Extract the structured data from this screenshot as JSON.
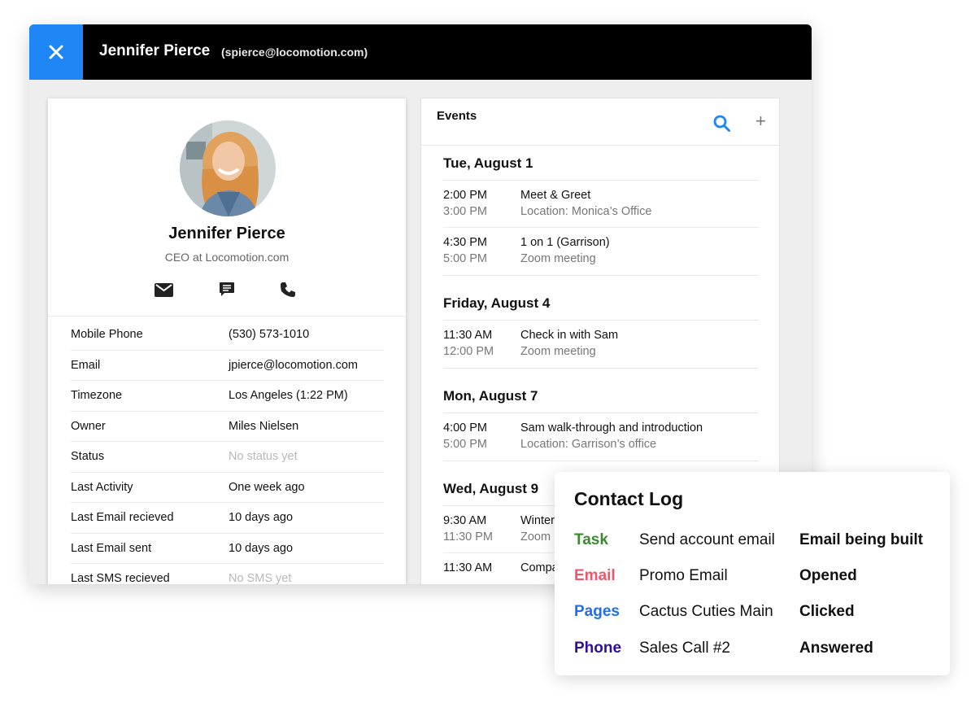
{
  "window": {
    "title_name": "Jennifer Pierce",
    "title_email": "(spierce@locomotion.com)"
  },
  "profile": {
    "name": "Jennifer Pierce",
    "role": "CEO at Locomotion.com",
    "fields": [
      {
        "label": "Mobile Phone",
        "value": "(530) 573-1010",
        "muted": false
      },
      {
        "label": "Email",
        "value": "jpierce@locomotion.com",
        "muted": false
      },
      {
        "label": "Timezone",
        "value": "Los Angeles (1:22 PM)",
        "muted": false
      },
      {
        "label": "Owner",
        "value": "Miles Nielsen",
        "muted": false
      },
      {
        "label": "Status",
        "value": "No status yet",
        "muted": true
      },
      {
        "label": "Last Activity",
        "value": "One week ago",
        "muted": false
      },
      {
        "label": "Last Email recieved",
        "value": "10 days ago",
        "muted": false
      },
      {
        "label": "Last Email sent",
        "value": "10 days ago",
        "muted": false
      },
      {
        "label": "Last SMS recieved",
        "value": "No SMS yet",
        "muted": true
      }
    ]
  },
  "events": {
    "title": "Events",
    "add_label": "+",
    "days": [
      {
        "date": "Tue, August 1",
        "items": [
          {
            "start": "2:00 PM",
            "end": "3:00 PM",
            "name": "Meet & Greet",
            "detail": "Location: Monica’s Office"
          },
          {
            "start": "4:30 PM",
            "end": "5:00 PM",
            "name": "1 on 1 (Garrison)",
            "detail": "Zoom meeting"
          }
        ]
      },
      {
        "date": "Friday, August 4",
        "items": [
          {
            "start": "11:30 AM",
            "end": "12:00 PM",
            "name": "Check in with Sam",
            "detail": "Zoom meeting"
          }
        ]
      },
      {
        "date": "Mon, August 7",
        "items": [
          {
            "start": "4:00 PM",
            "end": "5:00 PM",
            "name": "Sam walk-through and introduction",
            "detail": "Location: Garrison’s office"
          }
        ]
      },
      {
        "date": "Wed, August 9",
        "items": [
          {
            "start": "9:30 AM",
            "end": "11:30 PM",
            "name": "Winter",
            "detail": "Zoom"
          },
          {
            "start": "11:30 AM",
            "end": "",
            "name": "Compa",
            "detail": ""
          }
        ]
      }
    ]
  },
  "contact_log": {
    "title": "Contact Log",
    "rows": [
      {
        "type": "Task",
        "color": "#3a8a2e",
        "item": "Send account email",
        "status": "Email being built"
      },
      {
        "type": "Email",
        "color": "#f0566a",
        "item": "Promo Email",
        "status": "Opened"
      },
      {
        "type": "Pages",
        "color": "#1f6ff0",
        "item": "Cactus Cuties Main",
        "status": "Clicked"
      },
      {
        "type": "Phone",
        "color": "#2e0f9c",
        "item": "Sales Call #2",
        "status": "Answered"
      }
    ]
  },
  "colors": {
    "accent": "#1f87f5",
    "titlebar": "#000000"
  }
}
